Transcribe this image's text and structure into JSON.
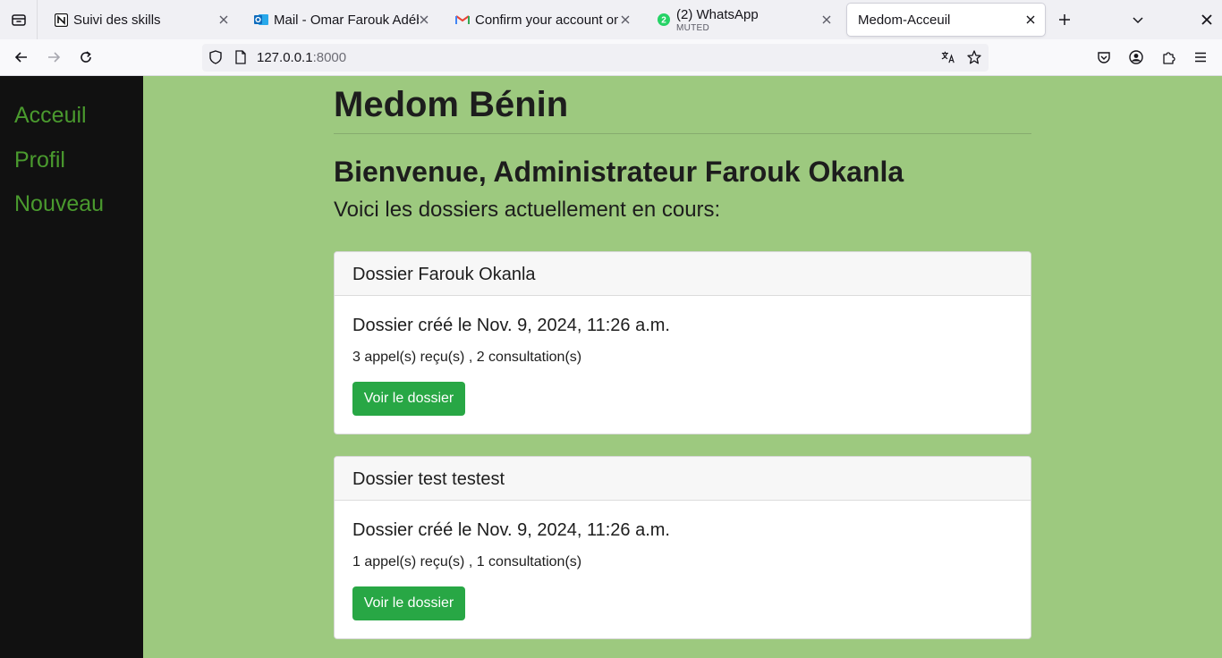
{
  "browser": {
    "tabs": [
      {
        "title": "Suivi des skills",
        "icon": "notion-icon"
      },
      {
        "title": "Mail - Omar Farouk Adébayo",
        "icon": "outlook-icon"
      },
      {
        "title": "Confirm your account on",
        "icon": "gmail-icon"
      },
      {
        "title": "(2) WhatsApp",
        "subtitle": "MUTED",
        "icon": "whatsapp-icon",
        "badge": "2"
      },
      {
        "title": "Medom-Acceuil",
        "icon": "none"
      }
    ],
    "url": {
      "host": "127.0.0.1",
      "port": ":8000"
    },
    "colors": {
      "tabbar": "#f0f0f4",
      "whatsapp": "#25d366",
      "outlook": "#0f6cbd",
      "gmail": "#ea4335"
    }
  },
  "sidebar": {
    "items": [
      {
        "label": "Acceuil"
      },
      {
        "label": "Profil"
      },
      {
        "label": "Nouveau"
      }
    ]
  },
  "main": {
    "site_title": "Medom Bénin",
    "welcome": "Bienvenue, Administrateur Farouk Okanla",
    "intro": "Voici les dossiers actuellement en cours:",
    "dossiers": [
      {
        "title": "Dossier Farouk Okanla",
        "date": "Dossier créé le Nov. 9, 2024, 11:26 a.m.",
        "stats": "3 appel(s) reçu(s) , 2 consultation(s)",
        "button": "Voir le dossier"
      },
      {
        "title": "Dossier test testest",
        "date": "Dossier créé le Nov. 9, 2024, 11:26 a.m.",
        "stats": "1 appel(s) reçu(s) , 1 consultation(s)",
        "button": "Voir le dossier"
      }
    ]
  },
  "theme": {
    "page_bg": "#9dc97f",
    "sidebar_bg": "#111111",
    "link": "#4a9a2e",
    "button": "#28a745"
  }
}
